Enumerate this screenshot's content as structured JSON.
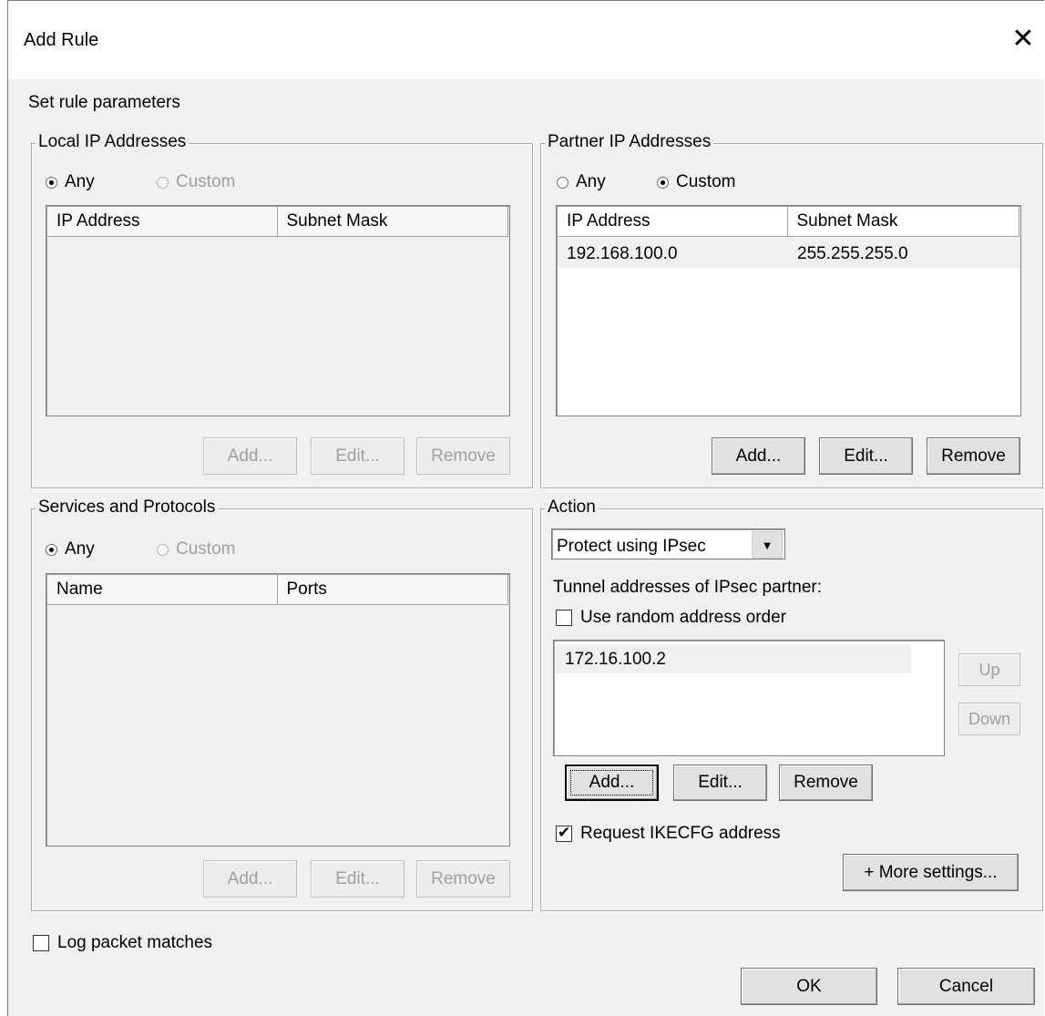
{
  "dialog": {
    "title": "Add Rule",
    "subtitle": "Set rule parameters",
    "close_icon": "close-icon"
  },
  "local": {
    "legend": "Local IP Addresses",
    "radio_any": "Any",
    "radio_custom": "Custom",
    "selected": "Any",
    "columns": [
      "IP Address",
      "Subnet Mask"
    ],
    "rows": [],
    "buttons": {
      "add": "Add...",
      "edit": "Edit...",
      "remove": "Remove"
    }
  },
  "partner": {
    "legend": "Partner IP Addresses",
    "radio_any": "Any",
    "radio_custom": "Custom",
    "selected": "Custom",
    "columns": [
      "IP Address",
      "Subnet Mask"
    ],
    "rows": [
      {
        "ip": "192.168.100.0",
        "mask": "255.255.255.0"
      }
    ],
    "buttons": {
      "add": "Add...",
      "edit": "Edit...",
      "remove": "Remove"
    }
  },
  "services": {
    "legend": "Services and Protocols",
    "radio_any": "Any",
    "radio_custom": "Custom",
    "selected": "Any",
    "columns": [
      "Name",
      "Ports"
    ],
    "rows": [],
    "buttons": {
      "add": "Add...",
      "edit": "Edit...",
      "remove": "Remove"
    }
  },
  "action": {
    "legend": "Action",
    "select_value": "Protect using IPsec",
    "tunnel_label": "Tunnel addresses of IPsec partner:",
    "random_order_label": "Use random address order",
    "random_order_checked": false,
    "tunnel_list": [
      "172.16.100.2"
    ],
    "buttons": {
      "up": "Up",
      "down": "Down",
      "add": "Add...",
      "edit": "Edit...",
      "remove": "Remove",
      "more_settings": "+ More settings..."
    },
    "ikecfg_label": "Request IKECFG  address",
    "ikecfg_checked": true
  },
  "footer": {
    "log_label": "Log packet matches",
    "log_checked": false,
    "ok": "OK",
    "cancel": "Cancel"
  }
}
